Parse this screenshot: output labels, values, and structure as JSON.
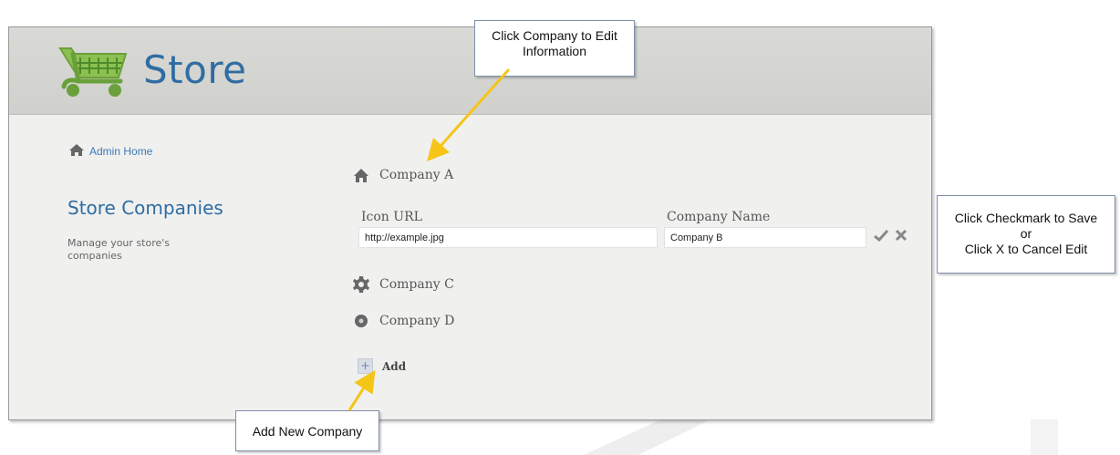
{
  "app": {
    "brand": "Store"
  },
  "nav": {
    "admin_home": "Admin Home"
  },
  "sidebar": {
    "title": "Store Companies",
    "description": "Manage your store's companies"
  },
  "companies": [
    {
      "name": "Company A",
      "icon": "home-icon"
    },
    {
      "name": "Company C",
      "icon": "gear-icon"
    },
    {
      "name": "Company D",
      "icon": "disc-icon"
    }
  ],
  "edit_form": {
    "icon_url_label": "Icon URL",
    "icon_url_value": "http://example.jpg",
    "company_name_label": "Company Name",
    "company_name_value": "Company B",
    "save_icon": "checkmark-icon",
    "cancel_icon": "close-icon"
  },
  "add": {
    "label": "Add",
    "icon": "plus-icon"
  },
  "callouts": {
    "edit": {
      "line1": "Click Company to Edit",
      "line2": "Information"
    },
    "save": {
      "line1": "Click Checkmark to Save",
      "line2": "or",
      "line3": "Click X to Cancel Edit"
    },
    "add": {
      "line1": "Add New Company"
    }
  },
  "colors": {
    "brand_blue": "#2f6da3",
    "link_blue": "#3a7ab8",
    "logo_green": "#7ab648",
    "arrow_yellow": "#f5c518"
  }
}
